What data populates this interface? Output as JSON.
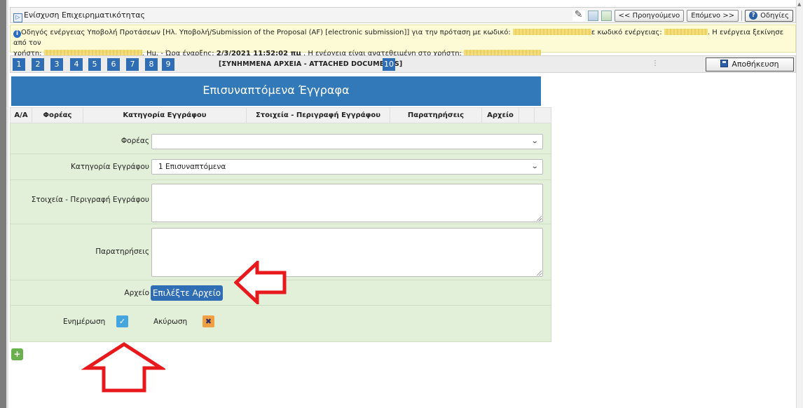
{
  "window": {
    "title": "Ενίσχυση Επιχειρηματικότητας"
  },
  "toolbar": {
    "prev_label": "<< Προηγούμενο",
    "next_label": "Επόμενο >>",
    "help_label": "Οδηγίες"
  },
  "info": {
    "part1": "Οδηγός ενέργειας Υποβολή Προτάσεων [Ηλ. Υποβολή/Submission of the Proposal (AF) [electronic submission]] για την πρόταση με κωδικό:",
    "part2": "ε κωδικό ενέργειας:",
    "part3": ". Η ενέργεια ξεκίνησε από τον",
    "part4": "χρήστη:",
    "part5": ". Ημ. - Ώρα έναρξης:",
    "start_datetime": "2/3/2021 11:52:02 πμ",
    "part6": ". Η ενέργεια είναι ανατεθειμένη στο χρήστη:"
  },
  "steps": [
    "1",
    "2",
    "3",
    "4",
    "5",
    "6",
    "7",
    "8",
    "9",
    "10"
  ],
  "current_step_title": "[ΣΥΝΗΜΜΕΝΑ ΑΡΧΕΙΑ - ATTACHED DOCUMENTS]",
  "save_label": "Αποθήκευση",
  "panel": {
    "title": "Επισυναπτόμενα Έγγραφα"
  },
  "table": {
    "columns": [
      "Α/Α",
      "Φορέας",
      "Κατηγορία Εγγράφου",
      "Στοιχεία - Περιγραφή Εγγράφου",
      "Παρατηρήσεις",
      "Αρχείο"
    ]
  },
  "form": {
    "foreas_label": "Φορέας",
    "foreas_value": "",
    "category_label": "Κατηγορία Εγγράφου",
    "category_value": "1 Επισυναπτόμενα",
    "description_label": "Στοιχεία - Περιγραφή Εγγράφου",
    "notes_label": "Παρατηρήσεις",
    "file_label": "Αρχείο",
    "file_button": "Επιλέξτε Αρχείο",
    "update_label": "Ενημέρωση",
    "cancel_label": "Ακύρωση"
  },
  "icons": {
    "update": "edit-check-icon",
    "cancel": "close-icon",
    "add": "plus-circle-icon",
    "save": "floppy-disk-icon",
    "help": "help-question-icon",
    "info": "info-icon"
  },
  "colors": {
    "accent": "#3279ba",
    "form_bg": "#e2f0d9",
    "info_bg": "#fdfbd6",
    "annotation_arrow": "#e8191c"
  }
}
